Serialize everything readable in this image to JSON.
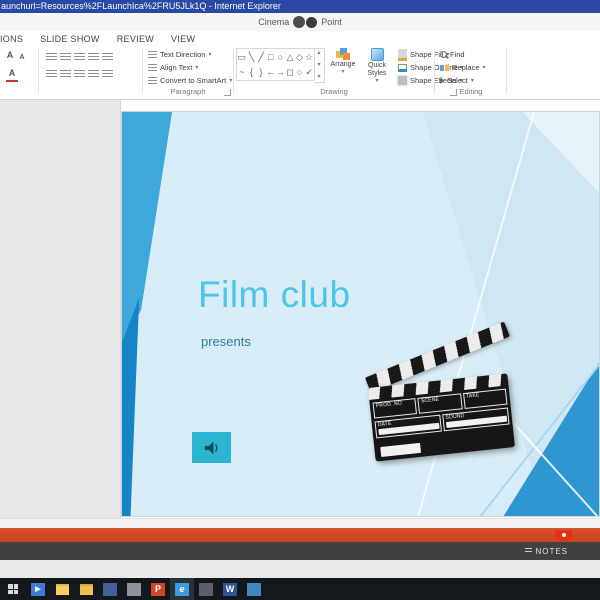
{
  "icons": {
    "dropdown": "▾",
    "scroll_up": "▴",
    "scroll_down": "▾",
    "more": "▾",
    "play": "▶",
    "grow_font": "A",
    "shrink_font": "A",
    "font_color": "A"
  },
  "ie_titlebar": {
    "title": "aunchurl=Resources%2FLaunchIca%2FRU5JLk1Q - Internet Explorer"
  },
  "app_titlebar": {
    "doc_name": "Cinema",
    "app_name": "Point"
  },
  "ribbon": {
    "tabs": [
      {
        "label": "IONS"
      },
      {
        "label": "SLIDE SHOW"
      },
      {
        "label": "REVIEW"
      },
      {
        "label": "VIEW"
      }
    ],
    "paragraph": {
      "text_direction": "Text Direction",
      "align_text": "Align Text",
      "convert_smartart": "Convert to SmartArt",
      "label": "Paragraph"
    },
    "drawing": {
      "shape_glyphs_row1": [
        "▭",
        "╲",
        "╱",
        "□",
        "○",
        "△",
        "◇",
        "☆"
      ],
      "shape_glyphs_row2": [
        "~",
        "{",
        "}",
        "←",
        "→",
        "◻",
        "○",
        "✓"
      ],
      "arrange": "Arrange",
      "quick_styles": "Quick Styles",
      "shape_fill": "Shape Fill",
      "shape_outline": "Shape Outline",
      "shape_effects": "Shape Effects",
      "label": "Drawing"
    },
    "editing": {
      "find": "Find",
      "replace": "Replace",
      "select": "Select",
      "label": "Editing"
    }
  },
  "slide": {
    "title": "Film club",
    "subtitle": "presents",
    "clapper": {
      "prod_no": "PROD. NO",
      "scene": "SCENE",
      "take": "TAKE",
      "date": "DATE",
      "sound": "SOUND"
    }
  },
  "statusbar": {
    "notes": "NOTES"
  },
  "taskbar": {
    "powerpoint_letter": "P",
    "ie_letter": "e",
    "word_letter": "W"
  },
  "colors": {
    "titlebar_blue": "#2a49a5",
    "slide_accent": "#2bb5d2",
    "slide_title": "#4cc5e6",
    "orange_bar": "#cf4a26"
  }
}
